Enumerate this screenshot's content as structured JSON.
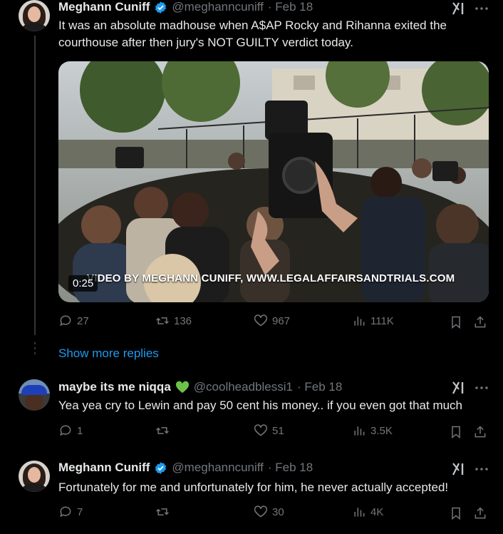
{
  "tweet1": {
    "name": "Meghann Cuniff",
    "handle": "@meghanncuniff",
    "date": "· Feb 18",
    "text": "It was an absolute madhouse when A$AP Rocky and Rihanna exited the courthouse after then jury's NOT GUILTY verdict today.",
    "video": {
      "duration": "0:25",
      "watermark": "VIDEO BY MEGHANN CUNIFF, WWW.LEGALAFFAIRSANDTRIALS.COM"
    },
    "stats": {
      "replies": "27",
      "reposts": "136",
      "likes": "967",
      "views": "111K"
    }
  },
  "show_more": "Show more replies",
  "reply1": {
    "name": "maybe its me niqqa",
    "handle": "@coolheadblessi1",
    "date": "· Feb 18",
    "text": "Yea yea cry to Lewin and pay 50 cent his money.. if you even got that much",
    "stats": {
      "replies": "1",
      "reposts": "",
      "likes": "51",
      "views": "3.5K"
    }
  },
  "reply2": {
    "name": "Meghann Cuniff",
    "handle": "@meghanncuniff",
    "date": "· Feb 18",
    "text": "Fortunately for me and unfortunately for him, he never actually accepted!",
    "stats": {
      "replies": "7",
      "reposts": "",
      "likes": "30",
      "views": "4K"
    }
  },
  "colors": {
    "background": "#000000",
    "text": "#e7e9ea",
    "muted": "#71767b",
    "link": "#1d9bf0",
    "verified": "#1d9bf0",
    "heart": "#6cc24a"
  },
  "icons": [
    "verified-badge-icon",
    "grok-icon",
    "more-icon",
    "reply-icon",
    "repost-icon",
    "like-icon",
    "views-icon",
    "bookmark-icon",
    "share-icon",
    "green-heart-emoji"
  ]
}
